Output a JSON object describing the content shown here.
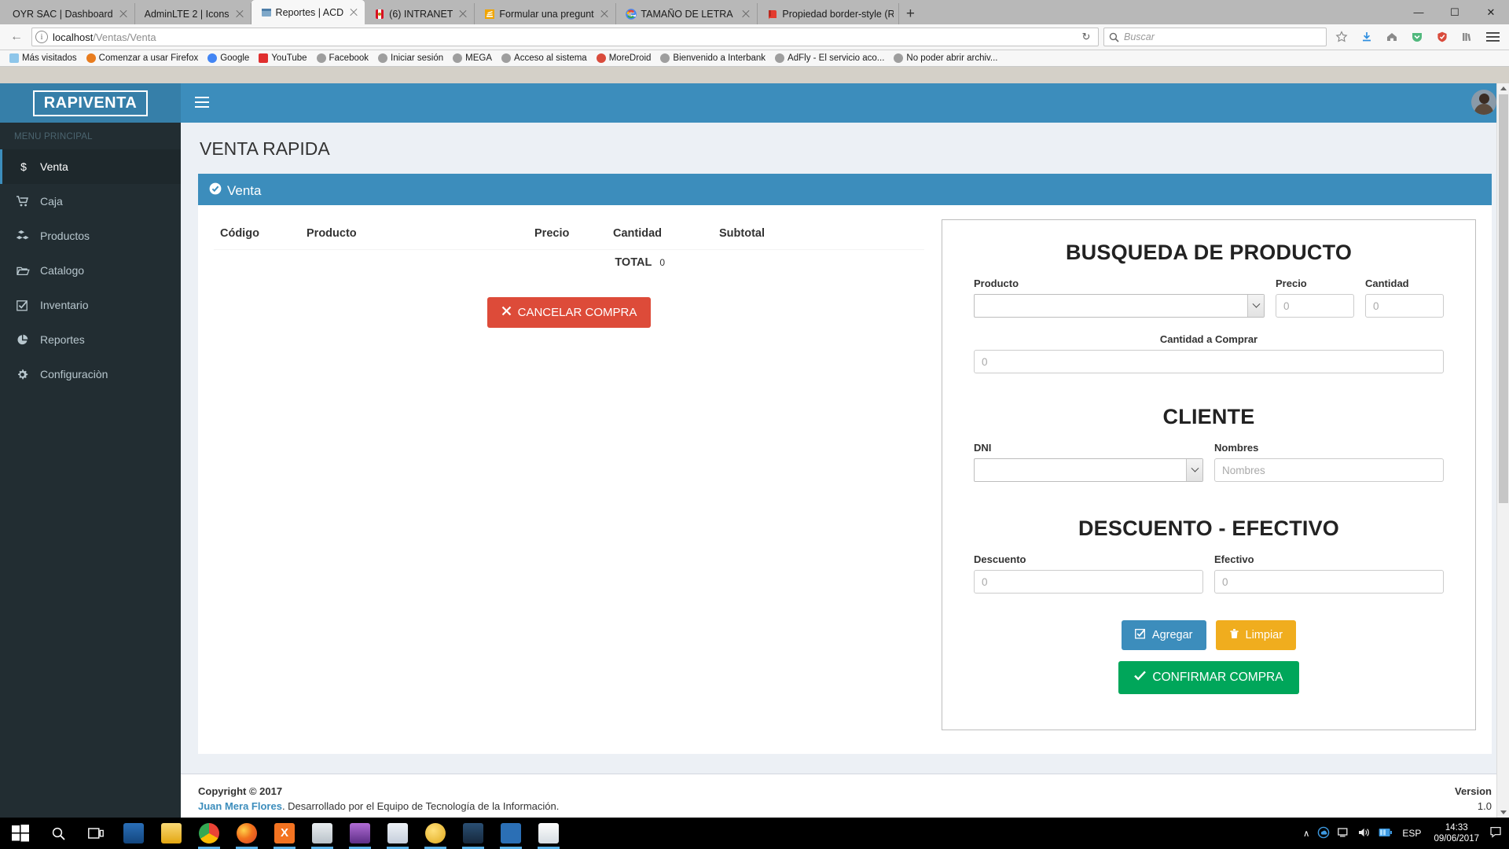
{
  "browser": {
    "tabs": [
      {
        "title": "OYR SAC | Dashboard",
        "favicon": "none",
        "active": false
      },
      {
        "title": "AdminLTE 2 | Icons",
        "favicon": "none",
        "active": false
      },
      {
        "title": "Reportes | ACD",
        "favicon": "window-icon",
        "active": true
      },
      {
        "title": "(6) INTRANET",
        "favicon": "peru-shield-icon",
        "active": false
      },
      {
        "title": "Formular una pregunta - Sta",
        "favicon": "stackoverflow-icon",
        "active": false
      },
      {
        "title": "TAMAÑO DE LETRA EN HTM",
        "favicon": "google-icon",
        "active": false
      },
      {
        "title": "Propiedad border-style (Ref",
        "favicon": "book-icon",
        "active": false
      }
    ],
    "new_tab_label": "+",
    "window_controls": {
      "minimize": "—",
      "maximize": "☐",
      "close": "✕"
    },
    "nav": {
      "back_label": "←",
      "url_prefix": "localhost",
      "url_suffix": "/Ventas/Venta",
      "reload_label": "↻",
      "search_placeholder": "Buscar",
      "star_icon": "star-icon",
      "download_icon": "download-icon",
      "home_icon": "home-icon",
      "pocket_icon": "pocket-icon",
      "shield_icon": "shield-icon",
      "library_icon": "library-icon",
      "menu_icon": "hamburger-icon"
    },
    "bookmarks": [
      {
        "label": "Más visitados",
        "color": "#8ec6ea"
      },
      {
        "label": "Comenzar a usar Firefox",
        "color": "#e87c1e"
      },
      {
        "label": "Google",
        "color": "#4285f4"
      },
      {
        "label": "YouTube",
        "color": "#e02f2f"
      },
      {
        "label": "Facebook",
        "color": "#9e9e9e"
      },
      {
        "label": "Iniciar sesión",
        "color": "#9e9e9e"
      },
      {
        "label": "MEGA",
        "color": "#9e9e9e"
      },
      {
        "label": "Acceso al sistema",
        "color": "#9e9e9e"
      },
      {
        "label": "MoreDroid",
        "color": "#d94b3c"
      },
      {
        "label": "Bienvenido a Interbank",
        "color": "#9e9e9e"
      },
      {
        "label": "AdFly - El servicio aco...",
        "color": "#9e9e9e"
      },
      {
        "label": "No poder abrir archiv...",
        "color": "#9e9e9e"
      }
    ]
  },
  "app": {
    "brand": "RAPIVENTA",
    "accent": "#3c8dbc",
    "sidebar_bg": "#222d32",
    "header_menu_icon": "hamburger-icon",
    "avatar_name": "user-avatar"
  },
  "sidebar": {
    "header": "MENU PRINCIPAL",
    "items": [
      {
        "label": "Venta",
        "icon": "dollar-icon",
        "active": true
      },
      {
        "label": "Caja",
        "icon": "shopping-cart-icon",
        "active": false
      },
      {
        "label": "Productos",
        "icon": "cubes-icon",
        "active": false
      },
      {
        "label": "Catalogo",
        "icon": "folder-open-icon",
        "active": false
      },
      {
        "label": "Inventario",
        "icon": "check-square-icon",
        "active": false
      },
      {
        "label": "Reportes",
        "icon": "pie-chart-icon",
        "active": false
      },
      {
        "label": "Configuraciòn",
        "icon": "gear-icon",
        "active": false
      }
    ]
  },
  "main": {
    "page_title": "VENTA RAPIDA",
    "box_title": "Venta",
    "box_title_icon": "check-circle-icon",
    "table": {
      "headers": [
        "Código",
        "Producto",
        "Precio",
        "Cantidad",
        "Subtotal"
      ],
      "rows": []
    },
    "total_label": "TOTAL",
    "total_value": "0",
    "cancel_button": {
      "label": "CANCELAR COMPRA",
      "icon": "times-icon",
      "color": "#dd4b39"
    }
  },
  "panel": {
    "search_section": {
      "title": "BUSQUEDA DE PRODUCTO",
      "producto_label": "Producto",
      "producto_value": "",
      "precio_label": "Precio",
      "precio_placeholder": "0",
      "precio_value": "",
      "cantidad_label": "Cantidad",
      "cantidad_placeholder": "0",
      "cantidad_value": "",
      "cantidad_comprar_label": "Cantidad a Comprar",
      "cantidad_comprar_placeholder": "0",
      "cantidad_comprar_value": ""
    },
    "cliente_section": {
      "title": "CLIENTE",
      "dni_label": "DNI",
      "dni_value": "",
      "nombres_label": "Nombres",
      "nombres_placeholder": "Nombres",
      "nombres_value": ""
    },
    "descuento_section": {
      "title": "DESCUENTO - EFECTIVO",
      "descuento_label": "Descuento",
      "descuento_placeholder": "0",
      "descuento_value": "",
      "efectivo_label": "Efectivo",
      "efectivo_placeholder": "0",
      "efectivo_value": ""
    },
    "buttons": {
      "agregar": {
        "label": "Agregar",
        "icon": "check-square-icon",
        "color": "#3c8dbc"
      },
      "limpiar": {
        "label": "Limpiar",
        "icon": "trash-icon",
        "color": "#f0ad1e"
      },
      "confirmar": {
        "label": "CONFIRMAR COMPRA",
        "icon": "check-icon",
        "color": "#00a65a"
      }
    }
  },
  "footer": {
    "copyright": "Copyright © 2017",
    "author": "Juan Mera Flores",
    "author_suffix": ". Desarrollado por el Equipo de Tecnología de la Información.",
    "version_label": "Version",
    "version_value": "1.0"
  },
  "taskbar": {
    "start_icon": "windows-start-icon",
    "search_icon": "search-icon",
    "taskview_icon": "task-view-icon",
    "apps": [
      {
        "name": "mail-icon",
        "color": "#1a6fbf",
        "running": false
      },
      {
        "name": "file-explorer-icon",
        "color": "#f7c948",
        "running": false
      },
      {
        "name": "chrome-icon",
        "color": "#e8453c",
        "running": true
      },
      {
        "name": "firefox-icon",
        "color": "#e8743b",
        "running": true
      },
      {
        "name": "xampp-icon",
        "color": "#f37321",
        "running": true
      },
      {
        "name": "sublime-icon",
        "color": "#dfe3e6",
        "running": true
      },
      {
        "name": "visual-studio-icon",
        "color": "#8b5ba8",
        "running": true
      },
      {
        "name": "word-icon",
        "color": "#2b579a",
        "running": true
      },
      {
        "name": "ares-icon",
        "color": "#f2c14e",
        "running": true
      },
      {
        "name": "netbeans-icon",
        "color": "#1b3a57",
        "running": true
      },
      {
        "name": "media-player-icon",
        "color": "#e8762b",
        "running": true
      },
      {
        "name": "paint-icon",
        "color": "#e8e8e8",
        "running": true
      }
    ],
    "tray": {
      "chevron": "∧",
      "icons": [
        "onedrive-icon",
        "network-icon",
        "volume-icon",
        "battery-icon"
      ],
      "language": "ESP",
      "time": "14:33",
      "date": "09/06/2017",
      "notification_icon": "notification-icon"
    }
  }
}
